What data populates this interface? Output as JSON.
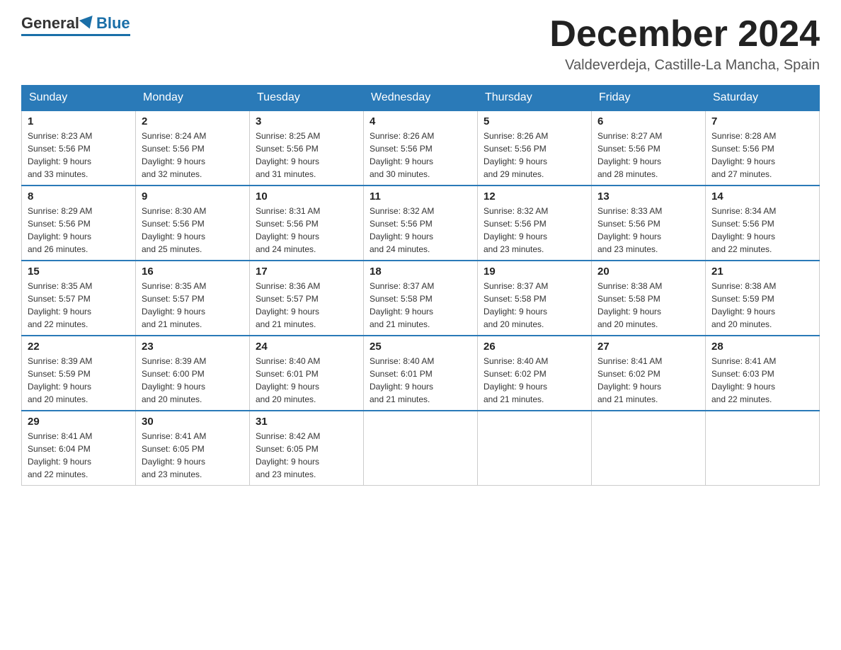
{
  "header": {
    "logo_general": "General",
    "logo_blue": "Blue",
    "month_title": "December 2024",
    "location": "Valdeverdeja, Castille-La Mancha, Spain"
  },
  "weekdays": [
    "Sunday",
    "Monday",
    "Tuesday",
    "Wednesday",
    "Thursday",
    "Friday",
    "Saturday"
  ],
  "weeks": [
    [
      {
        "day": "1",
        "sunrise": "8:23 AM",
        "sunset": "5:56 PM",
        "daylight": "9 hours and 33 minutes."
      },
      {
        "day": "2",
        "sunrise": "8:24 AM",
        "sunset": "5:56 PM",
        "daylight": "9 hours and 32 minutes."
      },
      {
        "day": "3",
        "sunrise": "8:25 AM",
        "sunset": "5:56 PM",
        "daylight": "9 hours and 31 minutes."
      },
      {
        "day": "4",
        "sunrise": "8:26 AM",
        "sunset": "5:56 PM",
        "daylight": "9 hours and 30 minutes."
      },
      {
        "day": "5",
        "sunrise": "8:26 AM",
        "sunset": "5:56 PM",
        "daylight": "9 hours and 29 minutes."
      },
      {
        "day": "6",
        "sunrise": "8:27 AM",
        "sunset": "5:56 PM",
        "daylight": "9 hours and 28 minutes."
      },
      {
        "day": "7",
        "sunrise": "8:28 AM",
        "sunset": "5:56 PM",
        "daylight": "9 hours and 27 minutes."
      }
    ],
    [
      {
        "day": "8",
        "sunrise": "8:29 AM",
        "sunset": "5:56 PM",
        "daylight": "9 hours and 26 minutes."
      },
      {
        "day": "9",
        "sunrise": "8:30 AM",
        "sunset": "5:56 PM",
        "daylight": "9 hours and 25 minutes."
      },
      {
        "day": "10",
        "sunrise": "8:31 AM",
        "sunset": "5:56 PM",
        "daylight": "9 hours and 24 minutes."
      },
      {
        "day": "11",
        "sunrise": "8:32 AM",
        "sunset": "5:56 PM",
        "daylight": "9 hours and 24 minutes."
      },
      {
        "day": "12",
        "sunrise": "8:32 AM",
        "sunset": "5:56 PM",
        "daylight": "9 hours and 23 minutes."
      },
      {
        "day": "13",
        "sunrise": "8:33 AM",
        "sunset": "5:56 PM",
        "daylight": "9 hours and 23 minutes."
      },
      {
        "day": "14",
        "sunrise": "8:34 AM",
        "sunset": "5:56 PM",
        "daylight": "9 hours and 22 minutes."
      }
    ],
    [
      {
        "day": "15",
        "sunrise": "8:35 AM",
        "sunset": "5:57 PM",
        "daylight": "9 hours and 22 minutes."
      },
      {
        "day": "16",
        "sunrise": "8:35 AM",
        "sunset": "5:57 PM",
        "daylight": "9 hours and 21 minutes."
      },
      {
        "day": "17",
        "sunrise": "8:36 AM",
        "sunset": "5:57 PM",
        "daylight": "9 hours and 21 minutes."
      },
      {
        "day": "18",
        "sunrise": "8:37 AM",
        "sunset": "5:58 PM",
        "daylight": "9 hours and 21 minutes."
      },
      {
        "day": "19",
        "sunrise": "8:37 AM",
        "sunset": "5:58 PM",
        "daylight": "9 hours and 20 minutes."
      },
      {
        "day": "20",
        "sunrise": "8:38 AM",
        "sunset": "5:58 PM",
        "daylight": "9 hours and 20 minutes."
      },
      {
        "day": "21",
        "sunrise": "8:38 AM",
        "sunset": "5:59 PM",
        "daylight": "9 hours and 20 minutes."
      }
    ],
    [
      {
        "day": "22",
        "sunrise": "8:39 AM",
        "sunset": "5:59 PM",
        "daylight": "9 hours and 20 minutes."
      },
      {
        "day": "23",
        "sunrise": "8:39 AM",
        "sunset": "6:00 PM",
        "daylight": "9 hours and 20 minutes."
      },
      {
        "day": "24",
        "sunrise": "8:40 AM",
        "sunset": "6:01 PM",
        "daylight": "9 hours and 20 minutes."
      },
      {
        "day": "25",
        "sunrise": "8:40 AM",
        "sunset": "6:01 PM",
        "daylight": "9 hours and 21 minutes."
      },
      {
        "day": "26",
        "sunrise": "8:40 AM",
        "sunset": "6:02 PM",
        "daylight": "9 hours and 21 minutes."
      },
      {
        "day": "27",
        "sunrise": "8:41 AM",
        "sunset": "6:02 PM",
        "daylight": "9 hours and 21 minutes."
      },
      {
        "day": "28",
        "sunrise": "8:41 AM",
        "sunset": "6:03 PM",
        "daylight": "9 hours and 22 minutes."
      }
    ],
    [
      {
        "day": "29",
        "sunrise": "8:41 AM",
        "sunset": "6:04 PM",
        "daylight": "9 hours and 22 minutes."
      },
      {
        "day": "30",
        "sunrise": "8:41 AM",
        "sunset": "6:05 PM",
        "daylight": "9 hours and 23 minutes."
      },
      {
        "day": "31",
        "sunrise": "8:42 AM",
        "sunset": "6:05 PM",
        "daylight": "9 hours and 23 minutes."
      },
      null,
      null,
      null,
      null
    ]
  ],
  "labels": {
    "sunrise": "Sunrise:",
    "sunset": "Sunset:",
    "daylight": "Daylight:"
  }
}
